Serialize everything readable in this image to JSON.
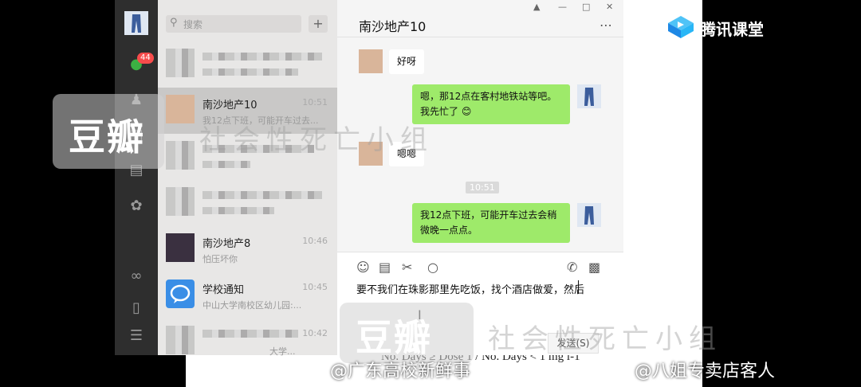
{
  "background": {
    "doc_text": "No. Days ≥ Dose 1 / No. Days < 1 mg l-1"
  },
  "tencent": {
    "label": "腾讯课堂",
    "color": "#31a6e5"
  },
  "rail": {
    "badge": "44"
  },
  "search": {
    "placeholder": "搜索",
    "add_label": "+"
  },
  "chat_list": [
    {
      "name": "",
      "time": "",
      "preview": "",
      "blurred": true
    },
    {
      "name": "南沙地产10",
      "time": "10:51",
      "preview": "我12点下班，可能开车过去...",
      "selected": true
    },
    {
      "name": "",
      "time": "",
      "preview": "",
      "blurred": true
    },
    {
      "name": "",
      "time": "",
      "preview": "",
      "blurred": true
    },
    {
      "name": "南沙地产8",
      "time": "10:46",
      "preview": "怕压坏你"
    },
    {
      "name": "学校通知",
      "time": "10:45",
      "preview": "中山大学南校区幼儿园:..."
    },
    {
      "name": "",
      "time": "10:42",
      "preview": "大学...",
      "blurred": true
    }
  ],
  "conversation": {
    "title": "南沙地产10",
    "messages": [
      {
        "side": "in",
        "text": "好呀"
      },
      {
        "side": "out",
        "text": "嗯，那12点在客村地铁站等吧。我先忙了",
        "emoji": "😊"
      },
      {
        "side": "in",
        "text": "嗯嗯"
      },
      {
        "side": "out",
        "text": "我12点下班，可能开车过去会稍微晚一点点。"
      }
    ],
    "time_chip": "10:51",
    "draft": "要不我们在珠影那里先吃饭，找个酒店做爱，然后",
    "send_label": "发送(S)"
  },
  "watermarks": {
    "douban": "豆瓣",
    "group": "社会性死亡小组",
    "weibo_left": "@广东高校新鲜事",
    "weibo_right": "@八姐专卖店客人"
  },
  "colors": {
    "accent_green": "#9eea6a",
    "rail": "#2e2e2e",
    "badge": "#f74c4c"
  }
}
